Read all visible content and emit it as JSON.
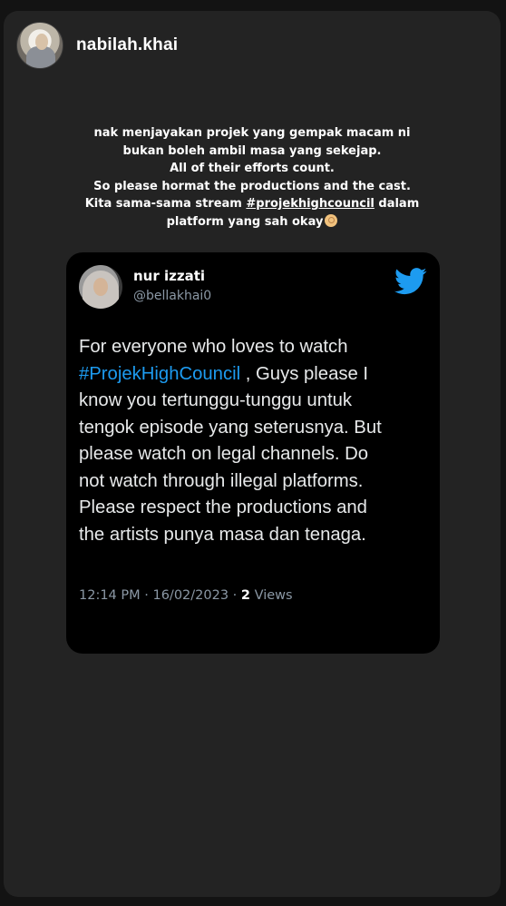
{
  "story": {
    "username": "nabilah.khai",
    "caption_lines": [
      "nak menjayakan projek yang gempak macam ni",
      "bukan boleh ambil masa yang sekejap.",
      "All of their efforts count.",
      "So please hormat the productions and the cast."
    ],
    "caption_line5_prefix": "Kita sama-sama stream ",
    "caption_hashtag": "#projekhighcouncil",
    "caption_line5_suffix": " dalam",
    "caption_line6": "platform yang sah okay",
    "emoji": "ok-hand-emoji"
  },
  "tweet": {
    "name": "nur izzati",
    "handle": "@bellakhai0",
    "icon": "twitter-bird-icon",
    "accent_color": "#1d9bf0",
    "text_line1": "For everyone who loves to watch",
    "text_hashtag": "#ProjekHighCouncil",
    "text_line2_suffix": " , Guys please I",
    "text_lines_rest": [
      "know you tertunggu-tunggu untuk",
      "tengok episode yang seterusnya. But",
      "please watch on legal channels. Do",
      "not watch through illegal platforms.",
      "Please respect the productions and",
      "the artists punya masa dan tenaga."
    ],
    "timestamp": "12:14 PM · 16/02/2023 · ",
    "views_count": "2",
    "views_label": " Views"
  }
}
